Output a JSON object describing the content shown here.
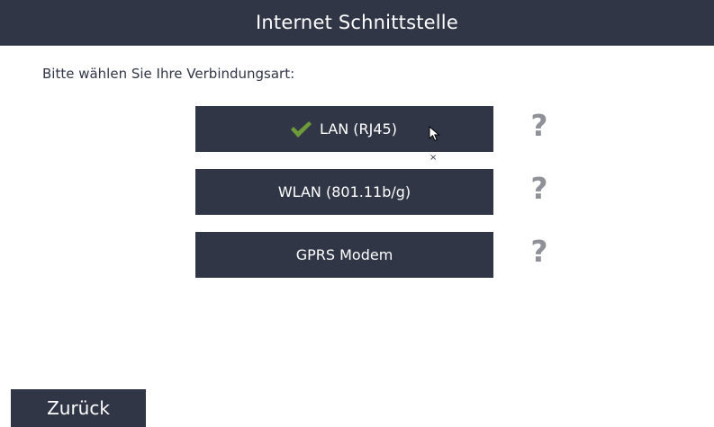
{
  "header": {
    "title": "Internet Schnittstelle"
  },
  "prompt": "Bitte wählen Sie Ihre Verbindungsart:",
  "options": [
    {
      "label": "LAN (RJ45)",
      "selected": true,
      "help": "?"
    },
    {
      "label": "WLAN (801.11b/g)",
      "selected": false,
      "help": "?"
    },
    {
      "label": "GPRS Modem",
      "selected": false,
      "help": "?"
    }
  ],
  "footer": {
    "back_label": "Zurück"
  },
  "misc": {
    "tiny_mark": "×"
  },
  "icons": {
    "selected": "check-icon",
    "help": "question-mark-icon",
    "pointer": "mouse-cursor-icon"
  },
  "colors": {
    "panel": "#303646",
    "check": "#6d9b3a",
    "help": "#8e9198",
    "text": "#ffffff"
  }
}
